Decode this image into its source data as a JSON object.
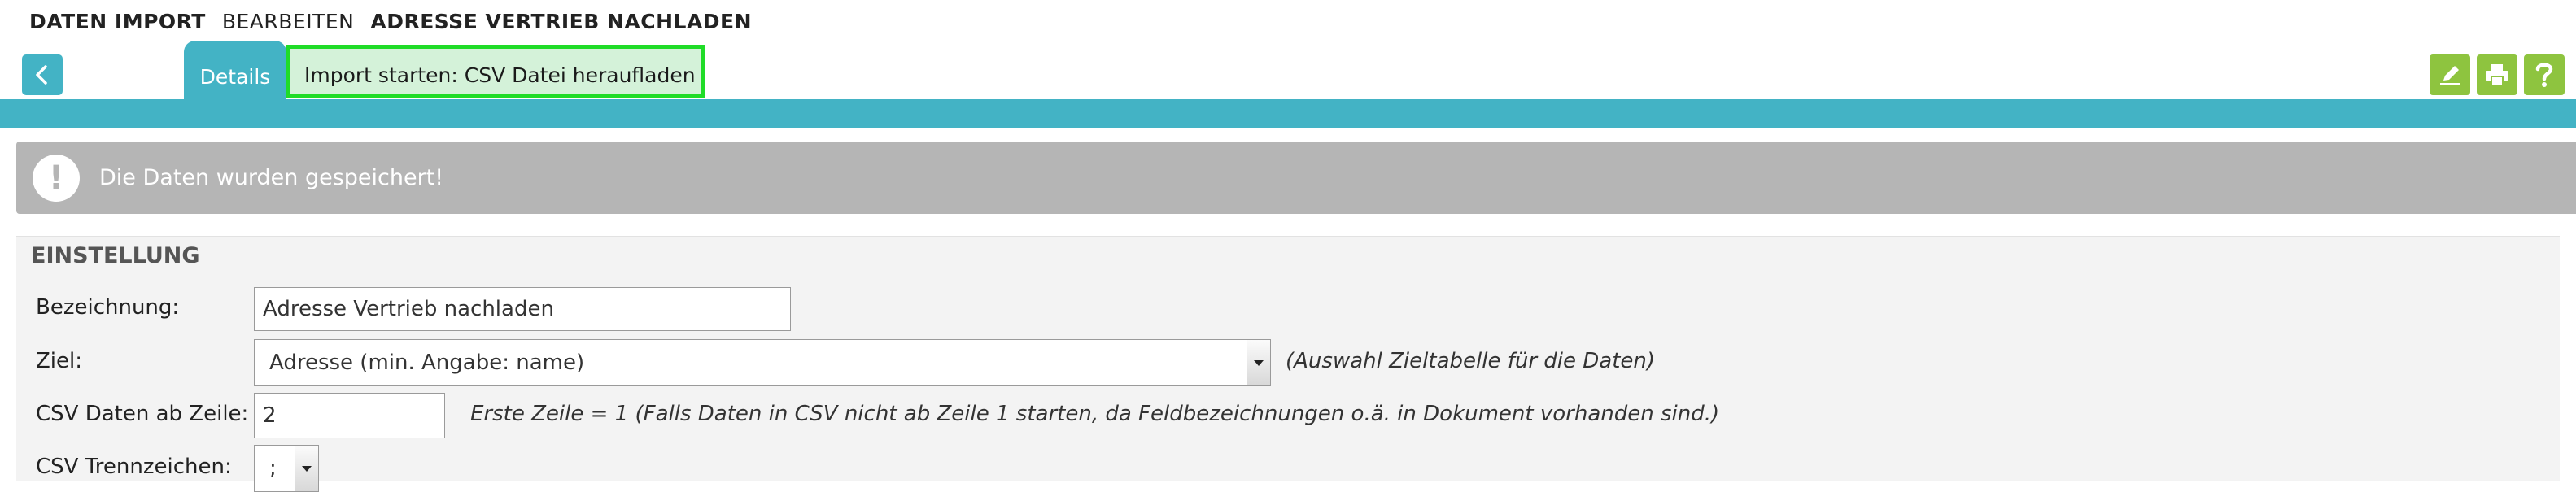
{
  "breadcrumb": {
    "part1": "DATEN IMPORT",
    "part2": "BEARBEITEN",
    "part3": "ADRESSE VERTRIEB NACHLADEN"
  },
  "tabs": {
    "details": "Details",
    "import": "Import starten: CSV Datei heraufladen"
  },
  "colors": {
    "accent": "#43b3c5",
    "tool_green": "#8ec43f",
    "highlight_border": "#1fdc27",
    "alert_bg": "#b5b5b5"
  },
  "toolbar": {
    "icons": [
      "pencil-icon",
      "printer-icon",
      "question-icon"
    ]
  },
  "alert": {
    "icon": "exclamation-icon",
    "text": "Die Daten wurden gespeichert!"
  },
  "settings": {
    "title": "EINSTELLUNG",
    "bezeichnung_label": "Bezeichnung:",
    "bezeichnung_value": "Adresse Vertrieb nachladen",
    "ziel_label": "Ziel:",
    "ziel_value": "Adresse (min. Angabe: name)",
    "ziel_hint": "(Auswahl Zieltabelle für die Daten)",
    "csv_row_label": "CSV Daten ab Zeile:",
    "csv_row_value": "2",
    "csv_row_hint": "Erste Zeile = 1 (Falls Daten in CSV nicht ab Zeile 1 starten, da Feldbezeichnungen o.ä. in Dokument vorhanden sind.)",
    "separator_label": "CSV Trennzeichen:",
    "separator_value": ";"
  }
}
